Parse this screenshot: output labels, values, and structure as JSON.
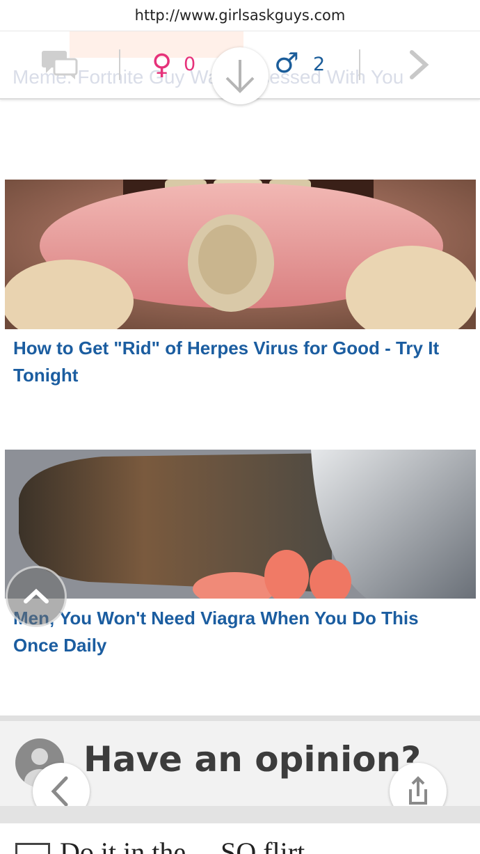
{
  "browser": {
    "url": "http://www.girlsaskguys.com"
  },
  "topbar": {
    "ghost_text": "Meme: Fortnite Guy Was Obsessed With You",
    "female_symbol": "♀",
    "female_count": "0",
    "male_symbol": "♂",
    "male_count": "2",
    "colors": {
      "female": "#e6327a",
      "male": "#1b5d9a"
    },
    "icons": [
      "chat-bubbles-icon",
      "arrow-down-icon",
      "chevron-right-icon"
    ]
  },
  "ads": [
    {
      "title": "How to Get \"Rid\" of Herpes Virus for Good - Try It Tonight",
      "image": "mouth-sore-photo"
    },
    {
      "title": "Men, You Won't Need Viagra When You Do This Once Daily",
      "image": "geoduck-clam-photo"
    }
  ],
  "opinion": {
    "title": "Have an opinion?",
    "icons": [
      "user-avatar-icon",
      "back-arrow-icon",
      "share-icon"
    ]
  },
  "footer": {
    "partial_text": "Do it in the ... SO flirt..."
  }
}
